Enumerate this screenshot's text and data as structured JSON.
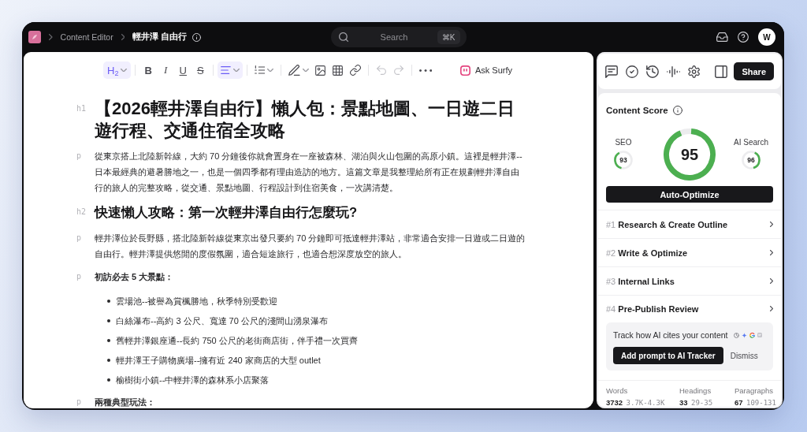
{
  "topbar": {
    "breadcrumbs": [
      {
        "label": "Content Editor",
        "current": false
      },
      {
        "label": "輕井澤 自由行",
        "current": true
      }
    ],
    "search": {
      "placeholder": "Search",
      "shortcut": "⌘K"
    },
    "avatar": "W"
  },
  "toolbar": {
    "groups": [
      [
        {
          "kind": "heading",
          "label": "H$_{2}$",
          "dropdown": true,
          "active": true,
          "disabled": false
        }
      ],
      [
        {
          "kind": "bold",
          "label": "B",
          "active": false,
          "disabled": false
        },
        {
          "kind": "italic",
          "label": "I",
          "active": false,
          "disabled": false
        },
        {
          "kind": "underline",
          "label": "U",
          "active": false,
          "disabled": false
        },
        {
          "kind": "strike",
          "label": "S",
          "active": false,
          "disabled": false
        }
      ],
      [
        {
          "kind": "align",
          "dropdown": true,
          "active": true,
          "disabled": false
        }
      ],
      [
        {
          "kind": "list",
          "dropdown": true,
          "active": false,
          "disabled": false
        }
      ],
      [
        {
          "kind": "pen",
          "dropdown": true,
          "active": false,
          "disabled": false
        },
        {
          "kind": "image",
          "active": false,
          "disabled": false
        },
        {
          "kind": "table",
          "active": false,
          "disabled": false
        },
        {
          "kind": "link",
          "active": false,
          "disabled": false
        }
      ],
      [
        {
          "kind": "undo",
          "active": false,
          "disabled": true
        },
        {
          "kind": "redo",
          "active": false,
          "disabled": true
        }
      ],
      [
        {
          "kind": "more",
          "active": false,
          "disabled": false
        }
      ]
    ],
    "assistant": "Ask Surfy"
  },
  "document": {
    "blocks": [
      {
        "kind": "h1",
        "tag": "h1",
        "text": "【2026輕井澤自由行】懶人包：景點地圖、一日遊二日遊行程、交通住宿全攻略"
      },
      {
        "kind": "p",
        "tag": "p",
        "bold": false,
        "text": "從東京搭上北陸新幹線，大約 70 分鐘後你就會置身在一座被森林、湖泊與火山包圍的高原小鎮。這裡是輕井澤--日本最經典的避暑勝地之一，也是一個四季都有理由造訪的地方。這篇文章是我整理給所有正在規劃輕井澤自由行的旅人的完整攻略，從交通、景點地圖、行程設計到住宿美食，一次講清楚。"
      },
      {
        "kind": "h2",
        "tag": "h2",
        "text": "快速懶人攻略：第一次輕井澤自由行怎麼玩?"
      },
      {
        "kind": "p",
        "tag": "p",
        "bold": false,
        "text": "輕井澤位於長野縣，搭北陸新幹線從東京出發只要約 70 分鐘即可抵達輕井澤站，非常適合安排一日遊或二日遊的自由行。輕井澤提供悠閒的度假氛圍，適合短途旅行，也適合想深度放空的旅人。"
      },
      {
        "kind": "p",
        "tag": "p",
        "bold": true,
        "text": "初訪必去 5 大景點："
      },
      {
        "kind": "list",
        "items": [
          "雲場池--被譽為賞楓勝地，秋季特別受歡迎",
          "白絲瀑布--高約 3 公尺、寬達 70 公尺的淺間山湧泉瀑布",
          "舊輕井澤銀座通--長約 750 公尺的老街商店街，伴手禮一次買齊",
          "輕井澤王子購物廣場--擁有近 240 家商店的大型 outlet",
          "榆樹街小鎮--中輕井澤的森林系小店聚落"
        ]
      },
      {
        "kind": "p",
        "tag": "p",
        "bold": true,
        "text": "兩種典型玩法："
      }
    ]
  },
  "panel": {
    "share": "Share",
    "content_score": {
      "title": "Content Score",
      "overall": {
        "value": "95",
        "level": 0.95
      },
      "scores": [
        {
          "label": "SEO",
          "value": "93",
          "level": 0.38
        },
        {
          "label": "AI Search",
          "value": "96",
          "level": 0.38
        }
      ],
      "action": "Auto-Optimize"
    },
    "steps": [
      {
        "number": "#1",
        "title": "Research & Create Outline"
      },
      {
        "number": "#2",
        "title": "Write & Optimize"
      },
      {
        "number": "#3",
        "title": "Internal Links"
      },
      {
        "number": "#4",
        "title": "Pre-Publish Review"
      }
    ],
    "tracker": {
      "text": "Track how AI cites your content",
      "primary": "Add prompt to AI Tracker",
      "secondary": "Dismiss"
    },
    "stats": [
      {
        "label": "Words",
        "value": "3732",
        "range": "3.7K-4.3K"
      },
      {
        "label": "Headings",
        "value": "33",
        "range": "29-35"
      },
      {
        "label": "Paragraphs",
        "value": "67",
        "range": "109-131"
      }
    ]
  }
}
